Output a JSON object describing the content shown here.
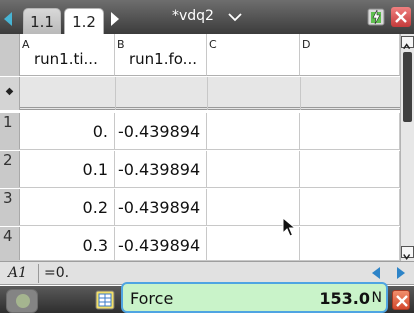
{
  "tabs": [
    {
      "label": "1.1",
      "active": false
    },
    {
      "label": "1.2",
      "active": true
    }
  ],
  "document": {
    "title": "*vdq2"
  },
  "spreadsheet": {
    "columns": [
      {
        "letter": "A",
        "name": "run1.ti..."
      },
      {
        "letter": "B",
        "name": "run1.fo..."
      },
      {
        "letter": "C",
        "name": ""
      },
      {
        "letter": "D",
        "name": ""
      }
    ],
    "formula_marker": "◆",
    "rows": [
      {
        "num": "1",
        "a": "0.",
        "b": "-0.439894"
      },
      {
        "num": "2",
        "a": "0.1",
        "b": "-0.439894"
      },
      {
        "num": "3",
        "a": "0.2",
        "b": "-0.439894"
      },
      {
        "num": "4",
        "a": "0.3",
        "b": "-0.439894"
      }
    ]
  },
  "cell_reference": {
    "cell": "A1",
    "value": "=0."
  },
  "sensor": {
    "name": "Force",
    "value": "153.0",
    "unit": "N"
  },
  "icons": {
    "battery": "battery-charging-icon",
    "close": "close-icon",
    "cursor": "mouse-pointer-icon"
  },
  "colors": {
    "sensor_panel": "#c9f3c9",
    "sensor_border": "#4fa4e2",
    "accent_blue": "#2d84c8",
    "close_red": "#d4492f"
  }
}
